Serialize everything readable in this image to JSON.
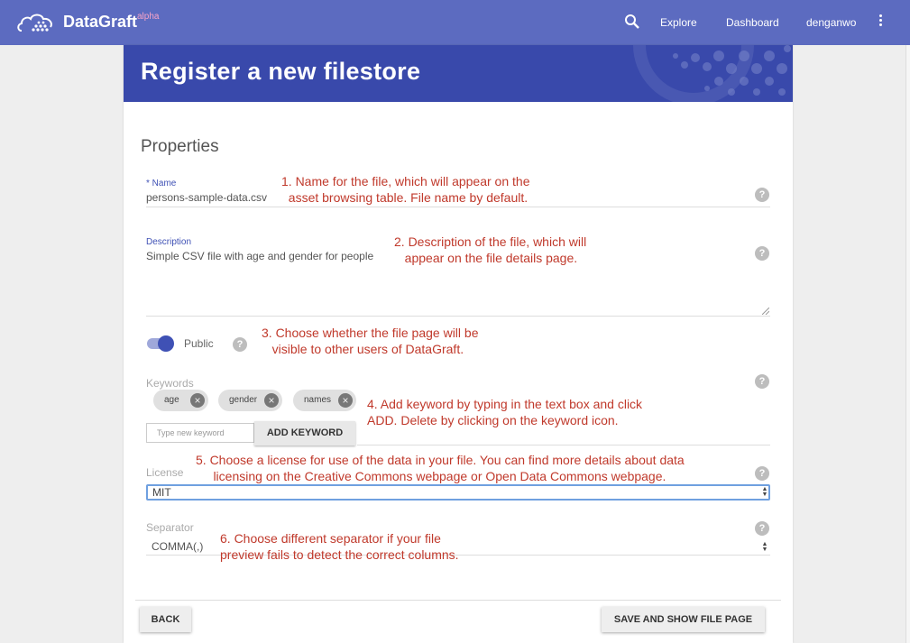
{
  "nav": {
    "brand": "DataGraft",
    "brand_badge": "alpha",
    "search_icon": "search-icon",
    "links": {
      "explore": "Explore",
      "dashboard": "Dashboard",
      "user": "denganwo"
    },
    "more_icon": "more-vert-icon"
  },
  "page": {
    "title": "Register a new filestore"
  },
  "form": {
    "section_title": "Properties",
    "name": {
      "label": "* Name",
      "value": "persons-sample-data.csv"
    },
    "description": {
      "label": "Description",
      "value": "Simple CSV file with age and gender for people"
    },
    "public": {
      "label": "Public",
      "checked": true
    },
    "keywords": {
      "label": "Keywords",
      "chips": [
        "age",
        "gender",
        "names"
      ],
      "input_placeholder": "Type new keyword",
      "add_button": "ADD KEYWORD"
    },
    "license": {
      "label": "License",
      "value": "MIT"
    },
    "separator": {
      "label": "Separator",
      "value": "COMMA(,)"
    }
  },
  "annotations": {
    "a1": "1. Name for the file, which will appear on the\n  asset browsing table. File name by default.",
    "a2": "2. Description of the file, which will\n   appear on the file details page.",
    "a3": "3. Choose whether the file page will be\n   visible to other users of DataGraft.",
    "a4": "4. Add keyword by typing in the text box and click\nADD. Delete by clicking on the keyword icon.",
    "a5": "5. Choose a license for use of the data in your file. You can find more details about data\n     licensing on the Creative Commons webpage or Open Data Commons webpage.",
    "a6": "6. Choose different separator if your file\npreview fails to detect the correct columns."
  },
  "footer": {
    "back": "BACK",
    "save": "SAVE AND SHOW FILE PAGE"
  },
  "colors": {
    "nav_bg": "#5c6bc0",
    "banner_bg": "#3949ab",
    "accent": "#3f51b5",
    "annotation": "#c0392b"
  }
}
